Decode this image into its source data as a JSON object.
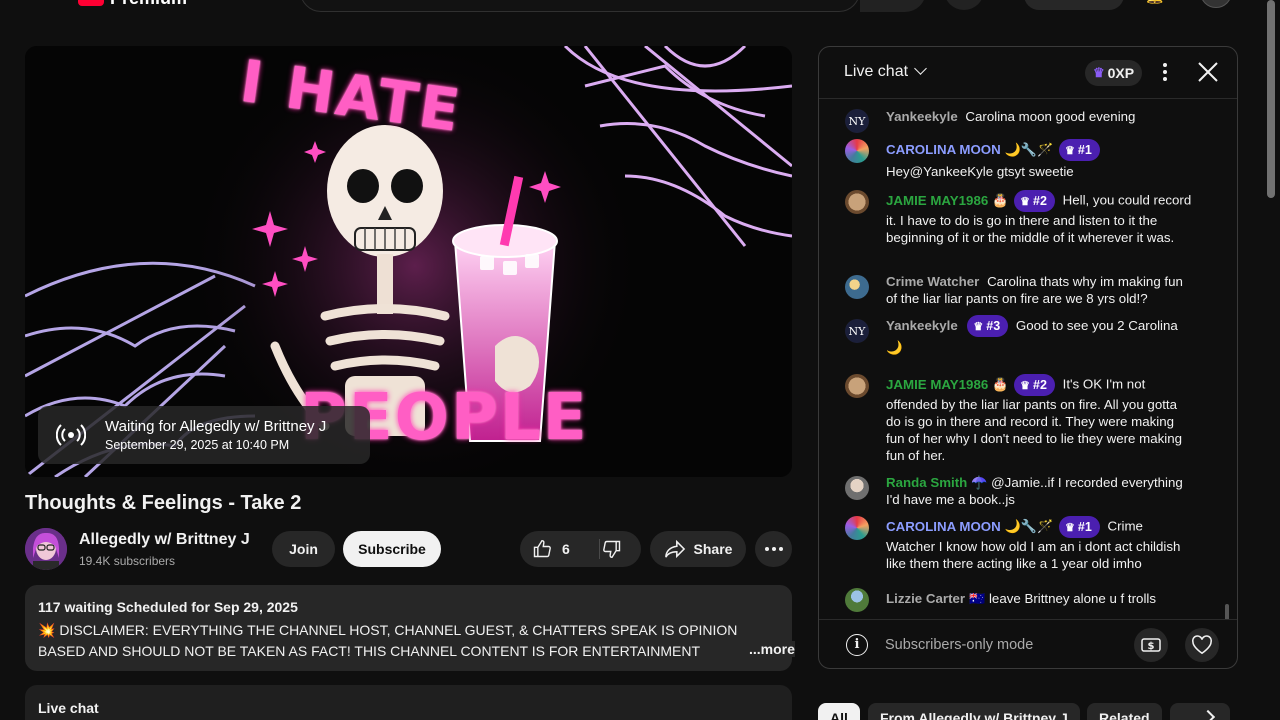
{
  "header": {
    "logo_text": "Premium"
  },
  "video": {
    "thumbnail_text_top": "I HATE",
    "thumbnail_text_bottom": "PEOPLE",
    "waiting_title": "Waiting for Allegedly w/ Brittney J",
    "scheduled_time": "September 29, 2025 at 10:40 PM",
    "title": "Thoughts & Feelings - Take 2"
  },
  "channel": {
    "name": "Allegedly w/ Brittney J",
    "subscribers": "19.4K subscribers",
    "join_label": "Join",
    "subscribe_label": "Subscribe"
  },
  "actions": {
    "like_count": "6",
    "share_label": "Share"
  },
  "description": {
    "meta": "117 waiting  Scheduled for Sep 29, 2025",
    "text": "💥 DISCLAIMER: EVERYTHING THE CHANNEL HOST, CHANNEL GUEST, & CHATTERS SPEAK IS OPINION BASED AND SHOULD NOT BE TAKEN AS FACT!  THIS CHANNEL CONTENT IS FOR ENTERTAINMENT PURPOSES!",
    "more_label": "...more"
  },
  "bottom_live_chat_label": "Live chat",
  "chat": {
    "title": "Live chat",
    "xp": "0XP",
    "footer_mode": "Subscribers-only mode",
    "messages": [
      {
        "author": "Yankeekyle",
        "author_color": "gray",
        "emojis": "",
        "badge": "",
        "text": "Carolina moon good evening"
      },
      {
        "author": "CAROLINA MOON",
        "author_color": "blue",
        "emojis": "🌙🔧🪄",
        "badge": "#1",
        "text": "Hey@YankeeKyle gtsyt sweetie"
      },
      {
        "author": "JAMIE MAY1986",
        "author_color": "green",
        "emojis": "🎂",
        "badge": "#2",
        "text": "Hell, you could record it. I have to do is go in there and listen to it the beginning of it or the middle of it wherever it was."
      },
      {
        "author": "Crime Watcher",
        "author_color": "gray",
        "emojis": "",
        "badge": "",
        "text": "Carolina thats why im making fun of the liar liar pants on fire are we 8 yrs old!?"
      },
      {
        "author": "Yankeekyle",
        "author_color": "gray",
        "emojis": "",
        "badge": "#3",
        "text": "Good to see you 2 Carolina 🌙"
      },
      {
        "author": "JAMIE MAY1986",
        "author_color": "green",
        "emojis": "🎂",
        "badge": "#2",
        "text": "It's OK I'm not offended by the liar liar pants on fire. All you gotta do is go in there and record it. They were making fun of her why I don't need to lie they were making fun of her."
      },
      {
        "author": "Randa Smith",
        "author_color": "green",
        "emojis": "☂️",
        "badge": "",
        "text": "@Jamie..if I recorded everything I'd have me a book..js"
      },
      {
        "author": "CAROLINA MOON",
        "author_color": "blue",
        "emojis": "🌙🔧🪄",
        "badge": "#1",
        "text": "Crime Watcher I know how old I am an i dont act childish like them there acting like a 1 year old imho"
      },
      {
        "author": "Lizzie Carter",
        "author_color": "gray",
        "emojis": "🇦🇺",
        "badge": "",
        "text": "leave Brittney alone u f trolls"
      }
    ]
  },
  "chips": [
    "All",
    "From Allegedly w/ Brittney J",
    "Related"
  ],
  "colors": {
    "accent_purple": "#4b1fb0",
    "author_blue": "#8c9dff",
    "author_green": "#2ba640",
    "neon_pink": "#ff5ec4"
  }
}
